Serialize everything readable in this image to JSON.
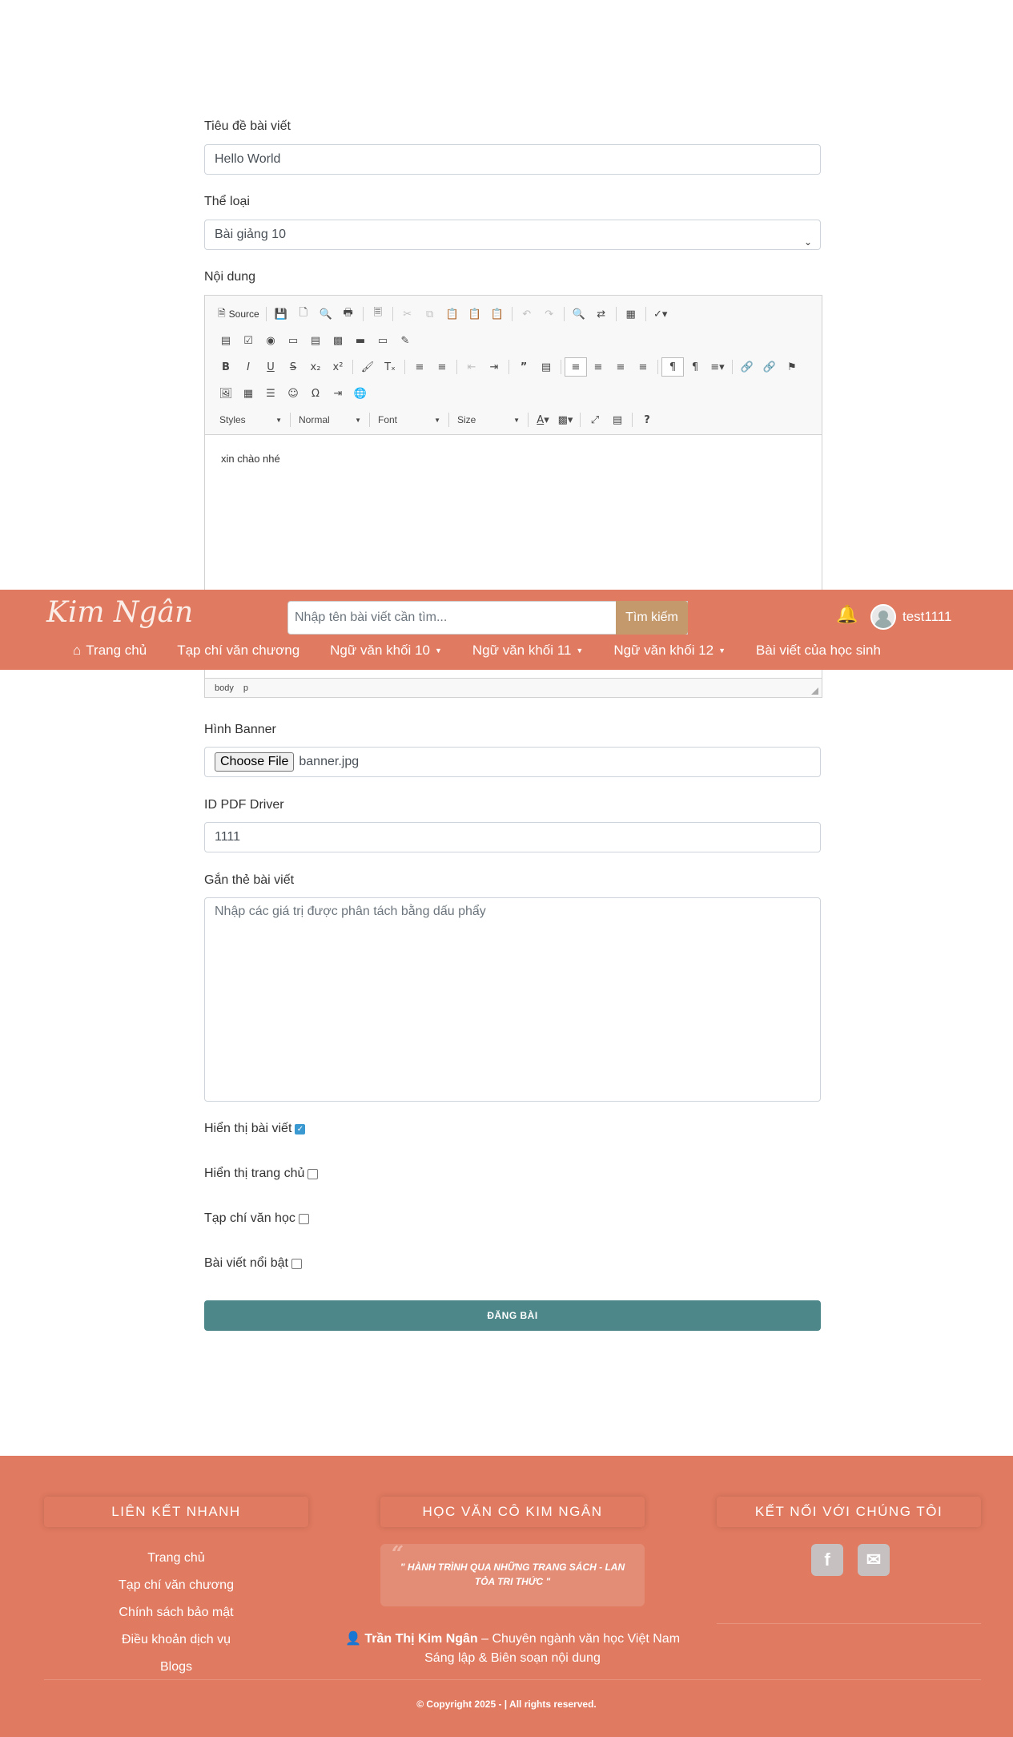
{
  "form": {
    "title_label": "Tiêu đề bài viết",
    "title_value": "Hello World",
    "category_label": "Thể loại",
    "category_value": "Bài giảng 10",
    "content_label": "Nội dung",
    "editor": {
      "source_label": "Source",
      "styles_label": "Styles",
      "format_label": "Normal",
      "font_label": "Font",
      "size_label": "Size",
      "content_text": "xin chào nhé",
      "path_body": "body",
      "path_p": "p"
    },
    "banner_label": "Hình Banner",
    "file_button": "Choose File",
    "file_name": "banner.jpg",
    "pdf_label": "ID PDF Driver",
    "pdf_value": "1111",
    "tags_label": "Gắn thẻ bài viết",
    "tags_placeholder": "Nhập các giá trị được phân tách bằng dấu phẩy",
    "checkboxes": [
      {
        "label": "Hiển thị bài viết",
        "checked": true
      },
      {
        "label": "Hiển thị trang chủ",
        "checked": false
      },
      {
        "label": "Tạp chí văn học",
        "checked": false
      },
      {
        "label": "Bài viết nổi bật",
        "checked": false
      }
    ],
    "submit_label": "ĐĂNG BÀI"
  },
  "navbar": {
    "logo": "Kim Ngân",
    "search_placeholder": "Nhập tên bài viết cần tìm...",
    "search_button": "Tìm kiếm",
    "username": "test1111",
    "menu": [
      {
        "label": "Trang chủ",
        "icon": "home-icon"
      },
      {
        "label": "Tạp chí văn chương"
      },
      {
        "label": "Ngữ văn khối 10",
        "dropdown": true
      },
      {
        "label": "Ngữ văn khối 11",
        "dropdown": true
      },
      {
        "label": "Ngữ văn khối 12",
        "dropdown": true
      },
      {
        "label": "Bài viết của học sinh"
      }
    ]
  },
  "footer": {
    "links_heading": "LIÊN KẾT NHANH",
    "links": [
      "Trang chủ",
      "Tạp chí văn chương",
      "Chính sách bảo mật",
      "Điều khoản dịch vụ",
      "Blogs"
    ],
    "about_heading": "HỌC VĂN CÔ KIM NGÂN",
    "quote": "\" HÀNH TRÌNH QUA NHỮNG TRANG SÁCH - LAN TỎA TRI THỨC \"",
    "author_name": "Trần Thị Kim Ngân",
    "author_role": " – Chuyên ngành văn học Việt Nam",
    "author_line2": "Sáng lập & Biên soạn nội dung",
    "connect_heading": "KẾT NỐI VỚI CHÚNG TÔI",
    "copyright": "© Copyright 2025 - | All rights reserved."
  },
  "colors": {
    "brand": "#e07a60",
    "search_button": "#c4996c",
    "submit": "#4e878a"
  }
}
